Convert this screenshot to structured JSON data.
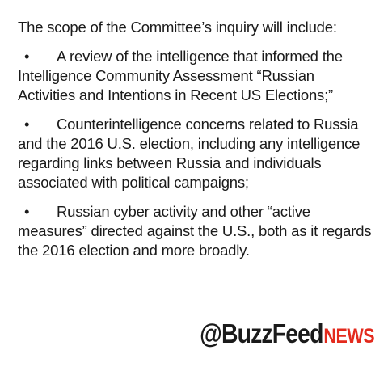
{
  "document": {
    "intro": "The scope of the Committee’s inquiry will include:",
    "bullet_glyph": "•",
    "items": [
      {
        "text": "A review of the intelligence that informed the Intelligence Community Assessment “Russian Activities and Intentions in Recent US Elections;”"
      },
      {
        "text": "Counterintelligence concerns related to Russia and the 2016 U.S. election, including any intelligence regarding links between Russia and individuals associated with political campaigns;"
      },
      {
        "text": "Russian cyber activity and other “active measures” directed against the U.S., both as it regards the 2016 election and more broadly."
      }
    ]
  },
  "logo": {
    "main": "@BuzzFeed",
    "news": "NEWS",
    "accent_color": "#e32a1d"
  }
}
